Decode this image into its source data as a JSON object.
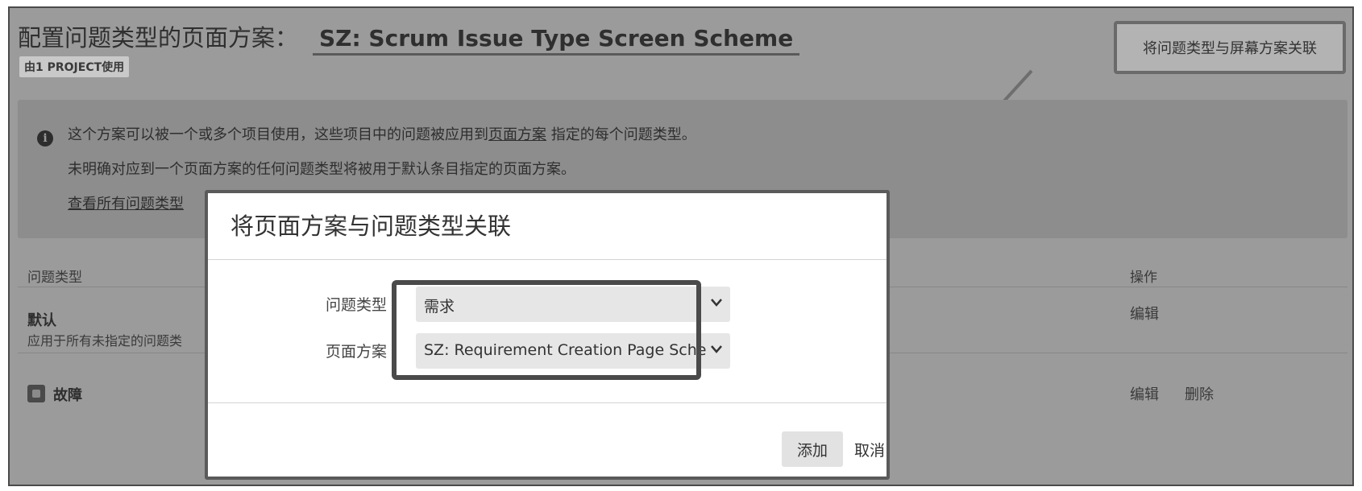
{
  "header": {
    "title_prefix": "配置问题类型的页面方案：",
    "scheme_name": "SZ: Scrum Issue Type Screen Scheme",
    "usage_badge": "由1 PROJECT使用",
    "associate_button": "将问题类型与屏幕方案关联"
  },
  "info": {
    "line1_a": "这个方案可以被一个或多个项目使用，这些项目中的问题被应用到",
    "line1_link": "页面方案",
    "line1_b": " 指定的每个问题类型。",
    "line2": "未明确对应到一个页面方案的任何问题类型将被用于默认条目指定的页面方案。",
    "line3_a": "查看",
    "line3_link": "所有问题类型"
  },
  "table": {
    "col_issue_type": "问题类型",
    "col_actions": "操作",
    "rows": [
      {
        "name": "默认",
        "desc": "应用于所有未指定的问题类",
        "edit": "编辑"
      },
      {
        "name": "故障",
        "edit": "编辑",
        "delete": "删除"
      }
    ]
  },
  "dialog": {
    "title": "将页面方案与问题类型关联",
    "issue_type_label": "问题类型",
    "issue_type_value": "需求",
    "screen_scheme_label": "页面方案",
    "screen_scheme_value": "SZ: Requirement Creation Page Sche",
    "add_button": "添加",
    "cancel_link": "取消"
  },
  "icons": {
    "info": "info-icon",
    "bug": "bug-icon",
    "chevron": "chevron-down-icon",
    "arrow": "annotation-arrow-icon"
  }
}
